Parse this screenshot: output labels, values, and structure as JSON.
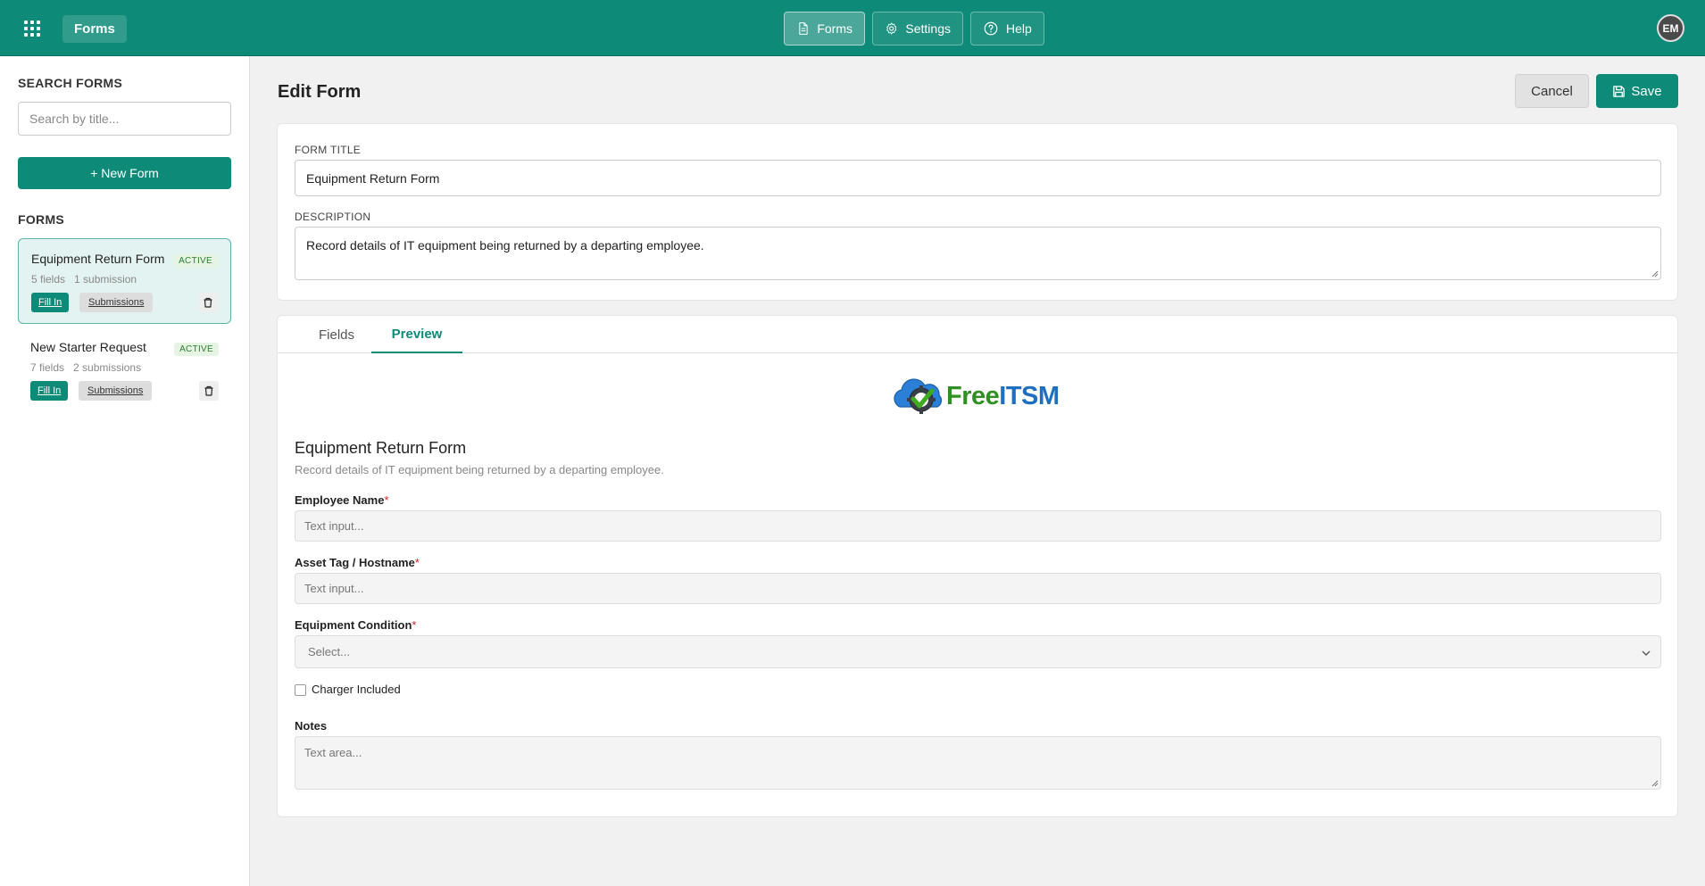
{
  "topbar": {
    "brand": "Forms",
    "nav": [
      {
        "label": "Forms",
        "icon": "document-icon",
        "active": true
      },
      {
        "label": "Settings",
        "icon": "gear-icon",
        "active": false
      },
      {
        "label": "Help",
        "icon": "help-icon",
        "active": false
      }
    ],
    "user_initials": "EM"
  },
  "sidebar": {
    "search_heading": "SEARCH FORMS",
    "search_placeholder": "Search by title...",
    "new_form_label": "+ New Form",
    "forms_heading": "FORMS",
    "forms": [
      {
        "title": "Equipment Return Form",
        "status": "ACTIVE",
        "fields": "5 fields",
        "submissions": "1 submission",
        "fill_in_label": "Fill In",
        "submissions_label": "Submissions",
        "selected": true
      },
      {
        "title": "New Starter Request",
        "status": "ACTIVE",
        "fields": "7 fields",
        "submissions": "2 submissions",
        "fill_in_label": "Fill In",
        "submissions_label": "Submissions",
        "selected": false
      }
    ]
  },
  "main": {
    "title": "Edit Form",
    "cancel_label": "Cancel",
    "save_label": "Save",
    "form_title_label": "FORM TITLE",
    "form_title_value": "Equipment Return Form",
    "description_label": "DESCRIPTION",
    "description_value": "Record details of IT equipment being returned by a departing employee.",
    "tabs": [
      {
        "label": "Fields",
        "active": false
      },
      {
        "label": "Preview",
        "active": true
      }
    ],
    "preview": {
      "logo_text_free": "Free",
      "logo_text_itsm": "ITSM",
      "title": "Equipment Return Form",
      "description": "Record details of IT equipment being returned by a departing employee.",
      "fields": [
        {
          "label": "Employee Name",
          "required": "*",
          "placeholder": "Text input..."
        },
        {
          "label": "Asset Tag / Hostname",
          "required": "*",
          "placeholder": "Text input..."
        },
        {
          "label": "Equipment Condition",
          "required": "*",
          "placeholder": "Select..."
        },
        {
          "label": "Charger Included"
        },
        {
          "label": "Notes",
          "placeholder": "Text area..."
        }
      ]
    }
  },
  "colors": {
    "accent": "#0e8a78",
    "active_badge_bg": "#e6f4e3",
    "active_badge_text": "#2e7d32",
    "required": "#c62828"
  }
}
